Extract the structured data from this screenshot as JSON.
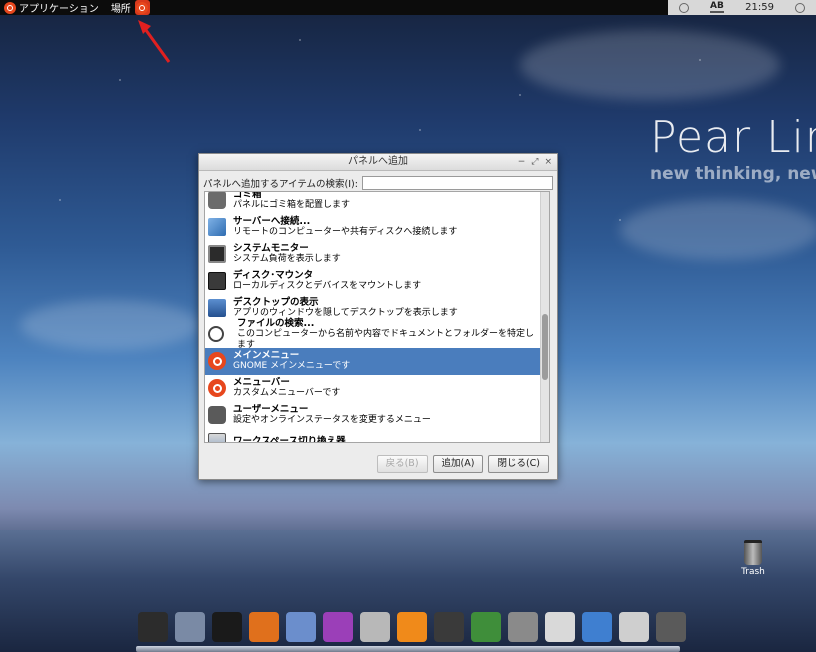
{
  "top_panel": {
    "applications_menu": "アプリケーション",
    "places_menu": "場所",
    "ime_indicator": "AB",
    "clock": "21:59"
  },
  "wallpaper": {
    "brand_text": "Pear Lin",
    "tagline": "new thinking, new p"
  },
  "dialog": {
    "title": "パネルへ追加",
    "title_controls": [
      "−",
      "⤢",
      "×"
    ],
    "search_label": "パネルへ追加するアイテムの検索(I):",
    "search_value": "",
    "items": [
      {
        "name": "ゴミ箱",
        "desc": "パネルにゴミ箱を配置します",
        "icon": "trash-icon",
        "selected": false
      },
      {
        "name": "サーバーへ接続...",
        "desc": "リモートのコンピューターや共有ディスクへ接続します",
        "icon": "server-icon",
        "selected": false
      },
      {
        "name": "システムモニター",
        "desc": "システム負荷を表示します",
        "icon": "system-monitor-icon",
        "selected": false
      },
      {
        "name": "ディスク･マウンタ",
        "desc": "ローカルディスクとデバイスをマウントします",
        "icon": "disk-icon",
        "selected": false
      },
      {
        "name": "デスクトップの表示",
        "desc": "アプリのウィンドウを隠してデスクトップを表示します",
        "icon": "show-desktop-icon",
        "selected": false
      },
      {
        "name": "ファイルの検索...",
        "desc": "このコンピューターから名前や内容でドキュメントとフォルダーを特定します",
        "icon": "search-icon",
        "selected": false
      },
      {
        "name": "メインメニュー",
        "desc": "GNOME メインメニューです",
        "icon": "ubuntu-icon",
        "selected": true
      },
      {
        "name": "メニューバー",
        "desc": "カスタムメニューバーです",
        "icon": "ubuntu-icon",
        "selected": false
      },
      {
        "name": "ユーザーメニュー",
        "desc": "設定やオンラインステータスを変更するメニュー",
        "icon": "chat-icon",
        "selected": false
      },
      {
        "name": "ワークスペース切り換え器",
        "desc": "",
        "icon": "workspace-icon",
        "selected": false
      }
    ],
    "buttons": {
      "back": "戻る(B)",
      "add": "追加(A)",
      "close": "閉じる(C)"
    }
  },
  "desktop": {
    "trash_label": "Trash"
  },
  "dock": {
    "icons": [
      "computer-icon",
      "rocket-icon",
      "terminal-icon",
      "firefox-icon",
      "photo-viewer-icon",
      "eye-icon",
      "disc-burner-icon",
      "vlc-icon",
      "app-store-icon",
      "network-icon",
      "camera-icon",
      "tools-icon",
      "cursor-icon",
      "control-panel-icon",
      "gimp-icon"
    ]
  }
}
